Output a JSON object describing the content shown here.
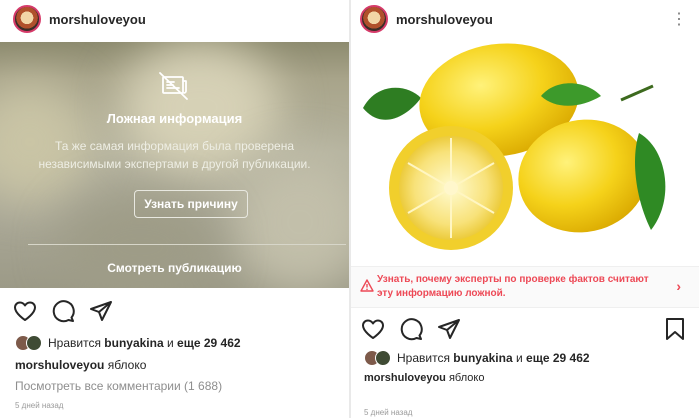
{
  "left": {
    "username": "morshuloveyou",
    "warning": {
      "title": "Ложная информация",
      "description": "Та же самая информация была проверена независимыми экспертами в другой публикации.",
      "reason_button": "Узнать причину",
      "see_post": "Смотреть публикацию"
    },
    "likes": {
      "prefix": "Нравится",
      "user": "bunyakina",
      "middle": "и",
      "rest": "еще 29 462"
    },
    "caption": {
      "user": "morshuloveyou",
      "text": "яблоко"
    },
    "comments_link": "Посмотреть все комментарии (1 688)",
    "date": "5 дней назад"
  },
  "right": {
    "username": "morshuloveyou",
    "fact_check": "Узнать, почему эксперты по проверке фактов считают эту информацию ложной.",
    "likes": {
      "prefix": "Нравится",
      "user": "bunyakina",
      "middle": "и",
      "rest": "еще 29 462"
    },
    "caption": {
      "user": "morshuloveyou",
      "text": "яблоко"
    },
    "date": "5 дней назад"
  },
  "colors": {
    "warning_red": "#ed4956",
    "avatar_ring": "#d63b6a"
  },
  "icons": [
    "heart-icon",
    "comment-icon",
    "share-icon",
    "bookmark-icon",
    "false-info-icon",
    "alert-icon",
    "chevron-right-icon",
    "more-icon"
  ]
}
